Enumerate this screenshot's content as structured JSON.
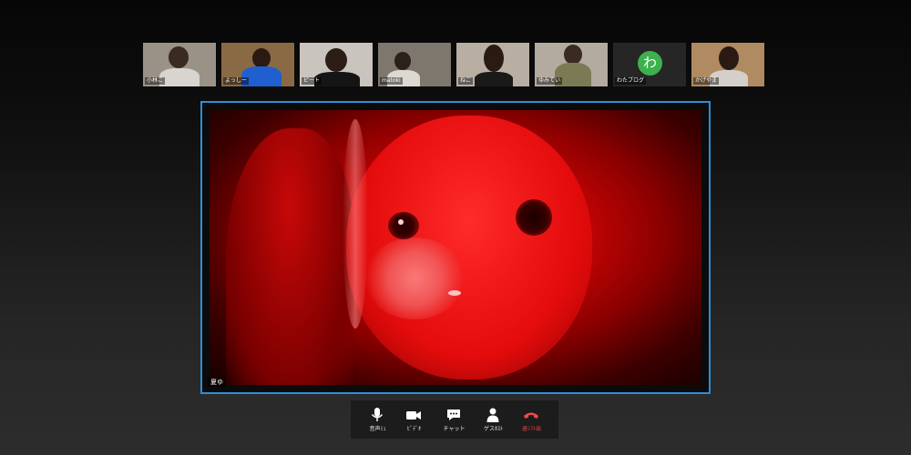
{
  "participants": [
    {
      "name": "小林こ",
      "initial": "",
      "bg": "#9a9286"
    },
    {
      "name": "よっしー",
      "initial": "",
      "bg": "#8a6a44"
    },
    {
      "name": "ピート",
      "initial": "",
      "bg": "#c9c4bd"
    },
    {
      "name": "matoki",
      "initial": "",
      "bg": "#7e776d"
    },
    {
      "name": "ねご",
      "initial": "",
      "bg": "#b9aea2"
    },
    {
      "name": "ゆみてい",
      "initial": "",
      "bg": "#b3aba0"
    },
    {
      "name": "わたブログ",
      "initial": "わ",
      "bg": "#262626"
    },
    {
      "name": "かげやま",
      "initial": "",
      "bg": "#b08a61"
    }
  ],
  "main_video": {
    "name": "夏ゆ"
  },
  "toolbar": {
    "mute_label": "音声ﾐｭ",
    "video_label": "ﾋﾞﾃﾞｵ",
    "chat_label": "チャット",
    "guest_label": "ゲスﾎｽﾄ",
    "leave_label": "退ｼﾌﾄ出"
  },
  "colors": {
    "active_border": "#2d8fd8",
    "avatar_green": "#3db14e",
    "leave_red": "#f24848"
  }
}
